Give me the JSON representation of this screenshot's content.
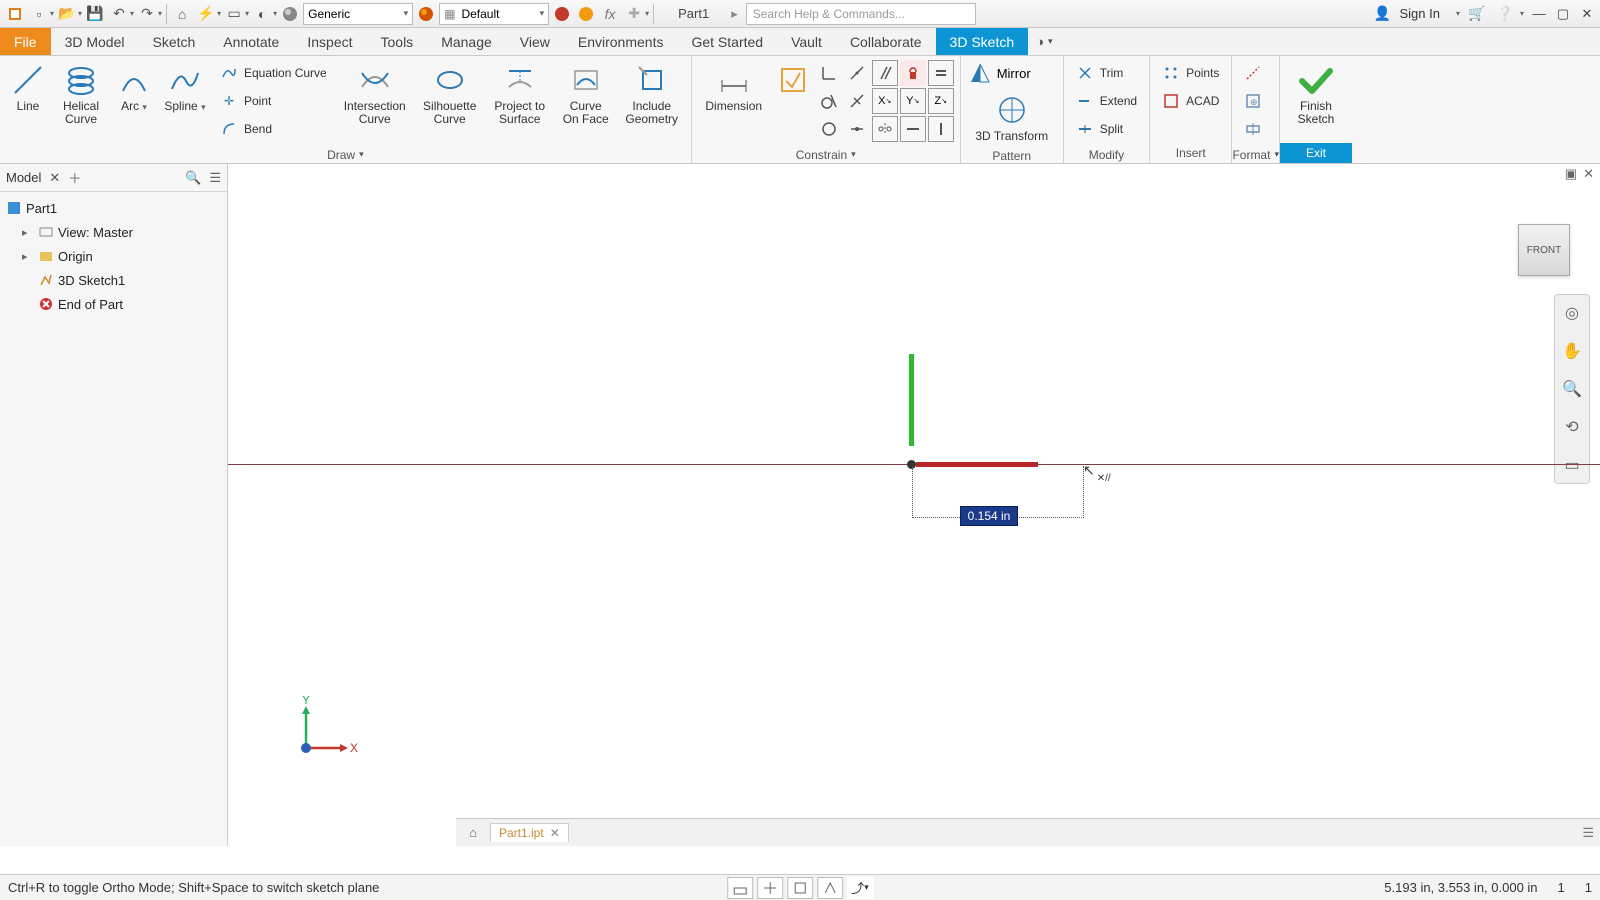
{
  "qat": {
    "combo1": "Generic",
    "combo2": "Default",
    "title": "Part1",
    "search_placeholder": "Search Help & Commands...",
    "signin": "Sign In"
  },
  "tabs": {
    "file": "File",
    "items": [
      "3D Model",
      "Sketch",
      "Annotate",
      "Inspect",
      "Tools",
      "Manage",
      "View",
      "Environments",
      "Get Started",
      "Vault",
      "Collaborate"
    ],
    "active": "3D Sketch"
  },
  "ribbon": {
    "line": "Line",
    "helical": "Helical\nCurve",
    "arc": "Arc",
    "spline": "Spline",
    "eqcurve": "Equation Curve",
    "point": "Point",
    "bend": "Bend",
    "intersection": "Intersection\nCurve",
    "silhouette": "Silhouette\nCurve",
    "project": "Project to\nSurface",
    "curveface": "Curve\nOn Face",
    "include": "Include\nGeometry",
    "dimension": "Dimension",
    "mirror": "Mirror",
    "transform": "3D Transform",
    "trim": "Trim",
    "extend": "Extend",
    "split": "Split",
    "points": "Points",
    "acad": "ACAD",
    "finish": "Finish\nSketch",
    "panel_draw": "Draw",
    "panel_constrain": "Constrain",
    "panel_pattern": "Pattern",
    "panel_modify": "Modify",
    "panel_insert": "Insert",
    "panel_format": "Format",
    "panel_exit": "Exit"
  },
  "browser": {
    "title": "Model",
    "root": "Part1",
    "view": "View: Master",
    "origin": "Origin",
    "sketch": "3D Sketch1",
    "eop": "End of Part"
  },
  "viewcube": "FRONT",
  "dim_value": "0.154 in",
  "triad": {
    "x": "X",
    "y": "Y"
  },
  "doctab": "Part1.ipt",
  "status": {
    "hint": "Ctrl+R to toggle Ortho Mode; Shift+Space to switch sketch plane",
    "coords": "5.193 in, 3.553 in, 0.000 in",
    "n1": "1",
    "n2": "1"
  }
}
